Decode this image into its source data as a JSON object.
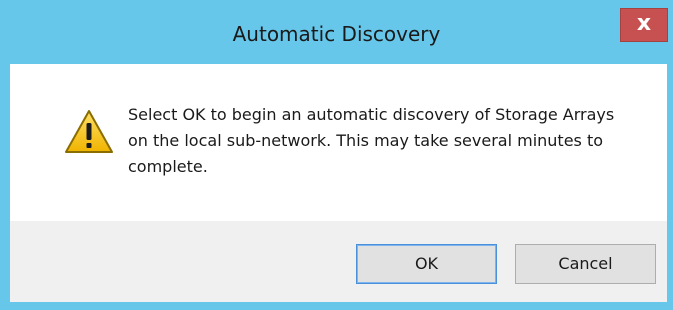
{
  "dialog": {
    "title": "Automatic Discovery",
    "close_label": "x",
    "message": "Select OK to begin an automatic discovery of Storage Arrays on the local sub-network.  This may take several minutes to complete.",
    "icon": "warning-icon",
    "buttons": {
      "ok_label": "OK",
      "cancel_label": "Cancel"
    }
  },
  "colors": {
    "titlebar": "#66c7ea",
    "close_button": "#c75050",
    "button_area": "#f0f0f0",
    "warning_fill": "#f5c518"
  }
}
